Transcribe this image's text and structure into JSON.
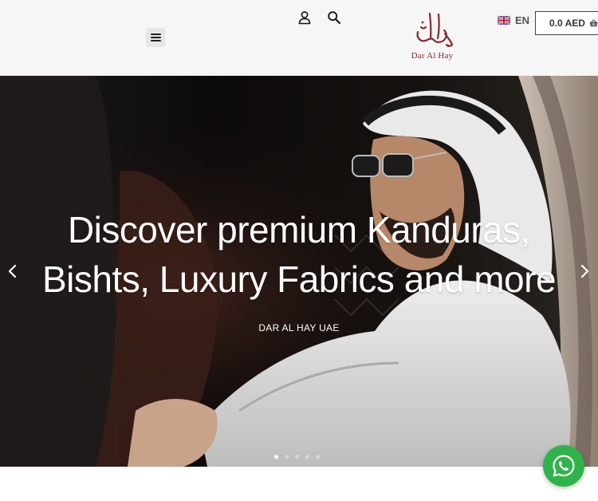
{
  "header": {
    "menu_icon": "hamburger-menu-icon",
    "account_icon": "user-icon",
    "search_icon": "search-icon",
    "logo_text": "Dar Al Hay",
    "logo_color": "#8a2a2a",
    "language": {
      "flag": "uk-flag-icon",
      "label": "EN"
    },
    "cart": {
      "amount": "0.0 AED",
      "icon": "basket-icon"
    }
  },
  "hero": {
    "title_line1": "Discover premium Kanduras,",
    "title_line2": "Bishts, Luxury Fabrics and more",
    "subtitle": "DAR AL HAY UAE",
    "prev_icon": "chevron-left-icon",
    "next_icon": "chevron-right-icon",
    "slide_count": 5,
    "active_slide": 1
  },
  "whatsapp": {
    "icon": "whatsapp-icon",
    "color": "#2fb34a"
  }
}
